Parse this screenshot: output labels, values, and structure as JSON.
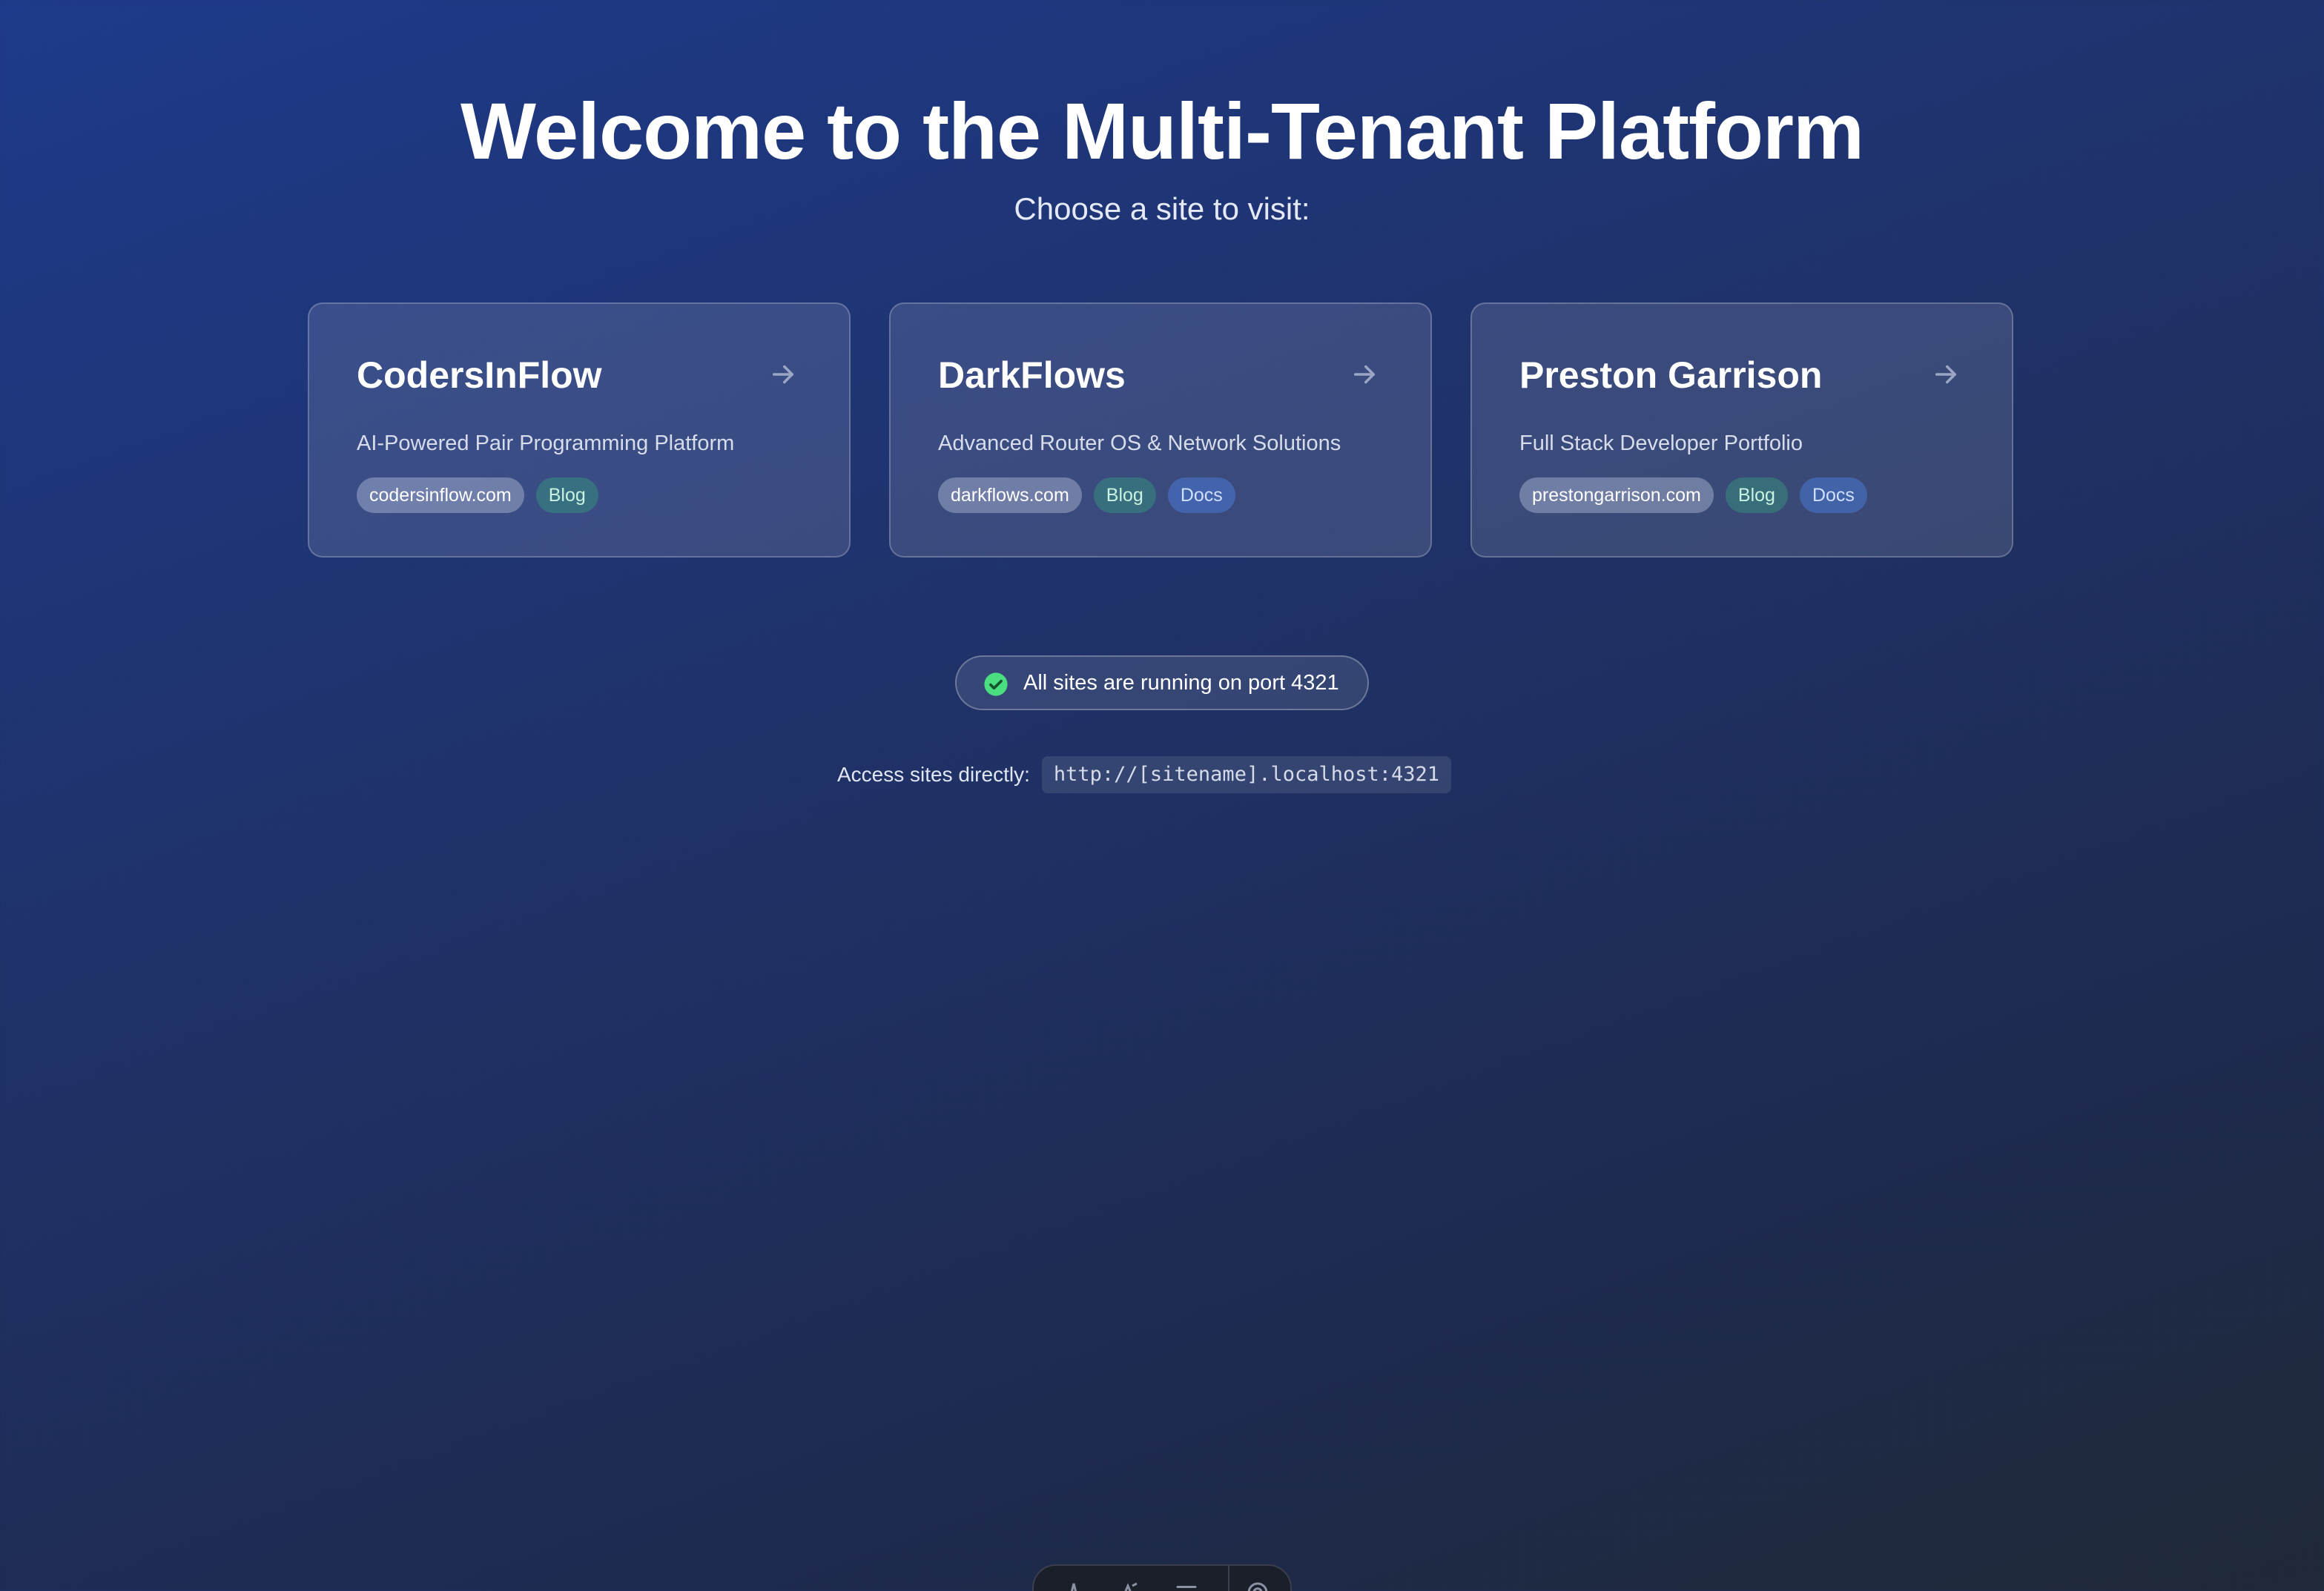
{
  "hero": {
    "title": "Welcome to the Multi-Tenant Platform",
    "subtitle": "Choose a site to visit:"
  },
  "sites": [
    {
      "name": "CodersInFlow",
      "description": "AI-Powered Pair Programming Platform",
      "domain": "codersinflow.com",
      "tags": [
        "Blog"
      ],
      "arrow_icon": "arrow-right-icon"
    },
    {
      "name": "DarkFlows",
      "description": "Advanced Router OS & Network Solutions",
      "domain": "darkflows.com",
      "tags": [
        "Blog",
        "Docs"
      ],
      "arrow_icon": "arrow-right-icon"
    },
    {
      "name": "Preston Garrison",
      "description": "Full Stack Developer Portfolio",
      "domain": "prestongarrison.com",
      "tags": [
        "Blog",
        "Docs"
      ],
      "arrow_icon": "arrow-right-icon"
    }
  ],
  "status": {
    "text": "All sites are running on port 4321",
    "icon": "check-circle-icon",
    "color": "#4ade80"
  },
  "access": {
    "label": "Access sites directly:",
    "code": "http://[sitename].localhost:4321"
  },
  "toolbar": {
    "icons": [
      "astro-logo-icon",
      "audit-icon",
      "menu-icon",
      "settings-icon"
    ]
  },
  "colors": {
    "background_start": "#1e3a8a",
    "background_end": "#1f2937",
    "blog_tag": "#34aa82",
    "docs_tag": "#5082e6"
  }
}
